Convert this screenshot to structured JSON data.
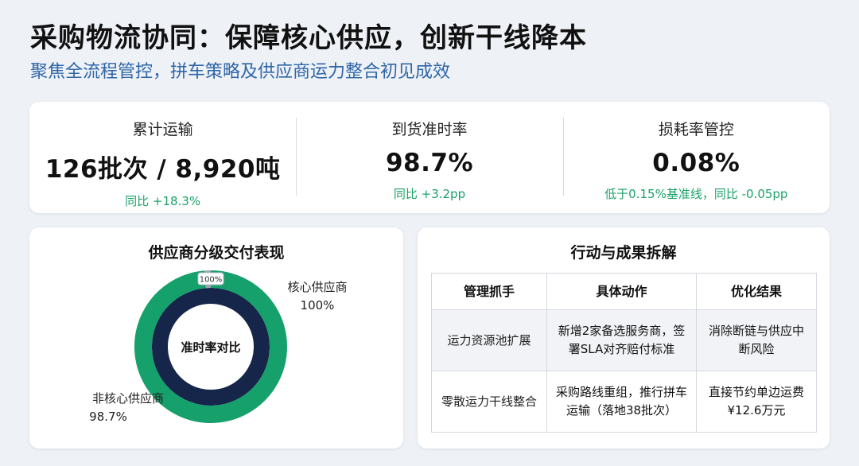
{
  "header": {
    "title": "采购物流协同：保障核心供应，创新干线降本",
    "subtitle": "聚焦全流程管控，拼车策略及供应商运力整合初见成效"
  },
  "kpis": [
    {
      "label": "累计运输",
      "value": "126批次 / 8,920吨",
      "change": "同比 +18.3%"
    },
    {
      "label": "到货准时率",
      "value": "98.7%",
      "change": "同比 +3.2pp"
    },
    {
      "label": "损耗率管控",
      "value": "0.08%",
      "change": "低于0.15%基准线，同比 -0.05pp"
    }
  ],
  "chart_card": {
    "title": "供应商分级交付表现"
  },
  "chart_data": {
    "type": "pie",
    "title": "供应商分级交付表现",
    "center_label": "准时率对比",
    "series": [
      {
        "name": "核心供应商",
        "value": 100,
        "value_label": "100%",
        "label": "核心供应商",
        "percent_text": "100%",
        "ring": "inner",
        "color": "#16264a"
      },
      {
        "name": "非核心供应商",
        "value": 98.7,
        "value_label": "98.7%",
        "label": "非核心供应商",
        "percent_text": "98.7%",
        "ring": "outer",
        "color": "#16a06b"
      }
    ],
    "marker_label": "100%",
    "gap_color": "#9aa3b4"
  },
  "table_card": {
    "title": "行动与成果拆解",
    "headers": [
      "管理抓手",
      "具体动作",
      "优化结果"
    ],
    "rows": [
      [
        "运力资源池扩展",
        "新增2家备选服务商，签署SLA对齐赔付标准",
        "消除断链与供应中断风险"
      ],
      [
        "零散运力干线整合",
        "采购路线重组，推行拼车运输（落地38批次）",
        "直接节约单边运费¥12.6万元"
      ]
    ]
  }
}
